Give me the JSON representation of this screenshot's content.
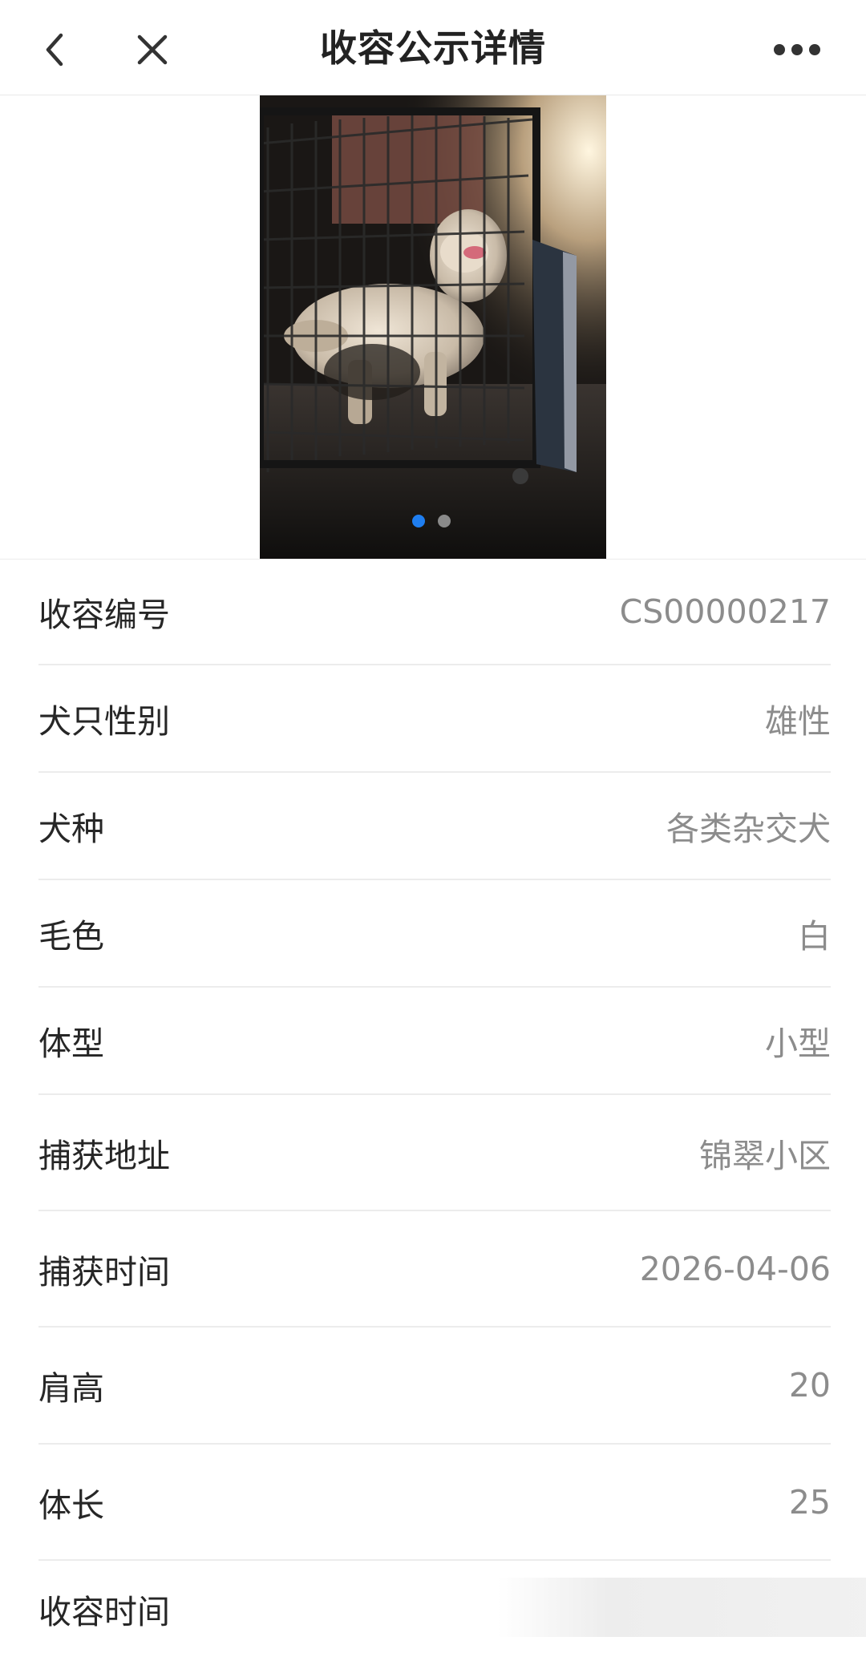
{
  "header": {
    "title": "收容公示详情",
    "back_icon": "chevron-left-icon",
    "close_icon": "close-icon",
    "more_icon": "more-dots-icon"
  },
  "carousel": {
    "image_count": 2,
    "active_index": 0,
    "active_dot_color": "#1f7ef0",
    "inactive_dot_color": "#8a8a8a"
  },
  "details": [
    {
      "label": "收容编号",
      "value": "CS00000217"
    },
    {
      "label": "犬只性别",
      "value": "雄性"
    },
    {
      "label": "犬种",
      "value": "各类杂交犬"
    },
    {
      "label": "毛色",
      "value": "白"
    },
    {
      "label": "体型",
      "value": "小型"
    },
    {
      "label": "捕获地址",
      "value": "锦翠小区"
    },
    {
      "label": "捕获时间",
      "value": "2026-04-06"
    },
    {
      "label": "肩高",
      "value": "20"
    },
    {
      "label": "体长",
      "value": "25"
    },
    {
      "label": "收容时间",
      "value": ""
    }
  ]
}
